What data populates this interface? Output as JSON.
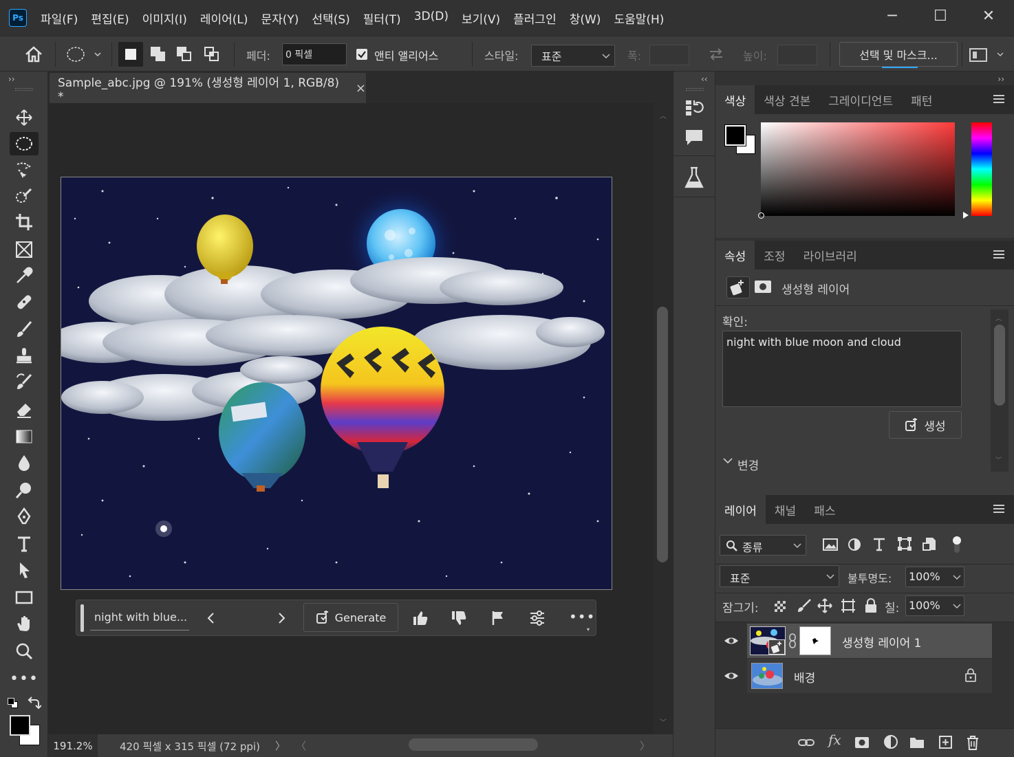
{
  "menu": [
    "파일(F)",
    "편집(E)",
    "이미지(I)",
    "레이어(L)",
    "문자(Y)",
    "선택(S)",
    "필터(T)",
    "3D(D)",
    "보기(V)",
    "플러그인",
    "창(W)",
    "도움말(H)"
  ],
  "app_logo": "Ps",
  "window_controls": {
    "minimize": "─",
    "maximize": "☐",
    "close": "✕"
  },
  "options": {
    "feather_label": "페더:",
    "feather_value": "0 픽셀",
    "antialias_label": "앤티 앨리어스",
    "antialias_checked": true,
    "style_label": "스타일:",
    "style_value": "표준",
    "width_label": "폭:",
    "height_label": "높이:",
    "select_mask_button": "선택 및 마스크..."
  },
  "document": {
    "tab_title": "Sample_abc.jpg @ 191% (생성형 레이어 1, RGB/8) *",
    "close": "×",
    "zoom": "191.2%",
    "doc_info": "420 픽셀 x 315 픽셀 (72 ppi)"
  },
  "contextual_bar": {
    "prompt_preview": "night with blue...",
    "generate_label": "Generate"
  },
  "color_panel": {
    "tabs": [
      "색상",
      "색상 견본",
      "그레이디언트",
      "패턴"
    ],
    "active_tab": 0,
    "foreground": "#000000",
    "background": "#ffffff",
    "hue_color": "#ff3b3b"
  },
  "properties_panel": {
    "tabs": [
      "속성",
      "조정",
      "라이브러리"
    ],
    "active_tab": 0,
    "layer_type": "생성형 레이어",
    "prompt_label": "확인:",
    "prompt_text": "night with blue moon and cloud",
    "generate_button": "생성",
    "variations_label": "변경"
  },
  "layers_panel": {
    "tabs": [
      "레이어",
      "채널",
      "패스"
    ],
    "active_tab": 0,
    "filter_label": "종류",
    "blend_mode": "표준",
    "opacity_label": "불투명도:",
    "opacity_value": "100%",
    "lock_label": "잠그기:",
    "fill_label": "칠:",
    "fill_value": "100%",
    "layers": [
      {
        "name": "생성형 레이어 1",
        "visible": true,
        "selected": true,
        "locked": false
      },
      {
        "name": "배경",
        "visible": true,
        "selected": false,
        "locked": true
      }
    ]
  },
  "colors": {
    "accent": "#31a8ff",
    "sky": "#12163f"
  }
}
